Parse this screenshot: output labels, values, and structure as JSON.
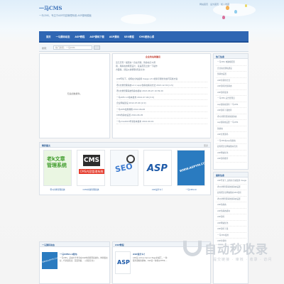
{
  "header": {
    "logo": "一马CMS",
    "slogan": "一马CMS，专注于ASP内容管理系统-ASP源码模板",
    "top_links": [
      "网站首页",
      "设为首页",
      "加入收藏"
    ]
  },
  "nav": {
    "items": [
      "首页",
      "一马源码动态",
      "ASP教程",
      "ASP源码下载",
      "ASP源码",
      "SEO教程",
      "CMS使用心得"
    ]
  },
  "subbar": {
    "label": "搜索：",
    "search_placeholder": "热门搜索：一马CMS"
  },
  "left_box": {
    "title": "",
    "empty_text": "无追加数据件。"
  },
  "mid_box": {
    "title": "企业免站助建议",
    "intro": "近几天有一发朋友一直在问我，伪静态怎么调用，用静态的网页设计，就是首页之前一下操作方面等，然后以前整理(阅读全文)",
    "items": [
      "ASP环境下，如何在全站使用 Usage v3.1搜索引擎优化技巧实施方案",
      "老k文章管理系统v2.1 (app)伪静态解决方法 2013-12-30 [1.5]",
      "老k文章管理系统伪静态模块 2013-08-23 10:39:20",
      "一马CMS 1.0版本发布 2012-07-09 [3.0]",
      "企业网站建设 2012-07-06 [2.0]",
      "一马CMS使用教程 2012-06-08",
      "CMS伪静态设置 2012-06-05",
      "一马cms2013年新版本发布 2012-09-01"
    ]
  },
  "right_top": {
    "title": "热门信息",
    "items": [
      "一马CMS 电脑端配置",
      "企业站主题站建设",
      "伪静态设置",
      "ASP的调用方式",
      "ASP源码的伪静态",
      "ASP源码使用",
      "一马CMS 后台管理员",
      "asp伪静态源码 一马CMS",
      "ASP源码下载推荐",
      "老k文章管理系统伪静态",
      "asp伪静态设置 一马CMS",
      "伪静态",
      "ASP文章源码",
      "一马CMS在asp伪静态",
      "如何把企业网站做好优化",
      "ASP网站优化",
      "ASP源码推荐"
    ]
  },
  "right_bottom": {
    "title": "最新信息",
    "items": [
      "ASP环境下_如何在全站使用 Usage v3.1 搜索",
      "老k文章管理系统伪静态设置",
      "如何把企业网站做好SEO优化",
      "老k文章管理系统伪静态设置",
      "ASP伪静态",
      "ASP伪静态模块",
      "ASP源码",
      "ASP网站优化",
      "ASP源码下载",
      "一马CMS使用",
      "ASP的调用"
    ]
  },
  "gallery": {
    "title": "精彩图文",
    "more": "更多",
    "items": [
      {
        "caption": "老k文章管理系统",
        "thumb_text": "老k文章管理系统"
      },
      {
        "caption": "CMS内容管理系统",
        "thumb_text": "CMS内容管理系统"
      },
      {
        "caption": "",
        "thumb_text": "SEO"
      },
      {
        "caption": "ASP是什么？",
        "thumb_text": "ASP"
      },
      {
        "caption": "一马CMS19",
        "thumb_text": "WWW.ASPYM.COM"
      }
    ]
  },
  "bottom_left": {
    "title": "一马源码动态",
    "item_title": "一马CMS1.0发布",
    "desc": "一马CMS，是由大牛作为在ASP内容管理系统的，体验很友好，代码很简洁，页面风格，…(阅读全文)",
    "thumb_text": "WWW.ASPYM.COM"
  },
  "bottom_mid": {
    "title": "ASP教程",
    "item_title": "ASP是什么？",
    "desc": "ASP是 Active Server Page的缩写，一种服务器端的脚本，ASP是一种类似HTML…",
    "thumb_text": "ASP"
  },
  "watermark": {
    "title": "自动秒收录",
    "sub": "提交链接 · 审核 · 收录 · 访问"
  },
  "colors": {
    "nav": "#2f66b3",
    "link": "#3d6fae",
    "title": "#2f5f97"
  }
}
